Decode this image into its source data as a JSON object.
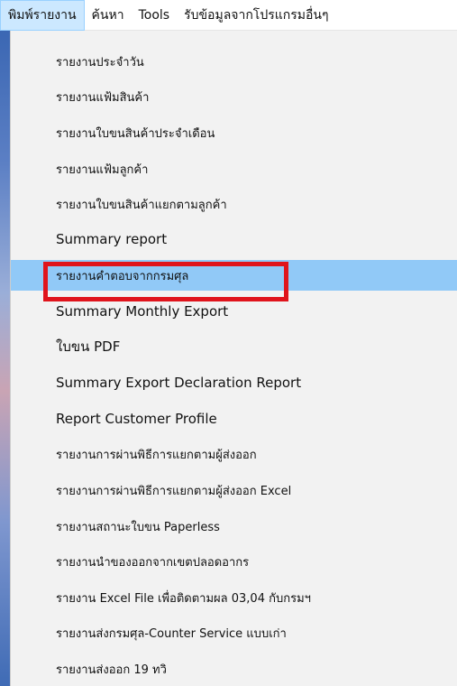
{
  "menubar": {
    "items": [
      {
        "label": "พิมพ์รายงาน"
      },
      {
        "label": "ค้นหา"
      },
      {
        "label": "Tools"
      },
      {
        "label": "รับข้อมูลจากโปรแกรมอื่นๆ"
      }
    ]
  },
  "dropdown": {
    "items": [
      {
        "label": "รายงานประจำวัน"
      },
      {
        "label": "รายงานแฟ้มสินค้า"
      },
      {
        "label": "รายงานใบขนสินค้าประจำเดือน"
      },
      {
        "label": "รายงานแฟ้มลูกค้า"
      },
      {
        "label": "รายงานใบขนสินค้าแยกตามลูกค้า"
      },
      {
        "label": "Summary report"
      },
      {
        "label": "รายงานคำตอบจากกรมศุล"
      },
      {
        "label": "Summary Monthly Export"
      },
      {
        "label": "ใบขน PDF"
      },
      {
        "label": "Summary Export Declaration Report"
      },
      {
        "label": "Report Customer Profile"
      },
      {
        "label": "รายงานการผ่านพิธีการแยกตามผู้ส่งออก"
      },
      {
        "label": "รายงานการผ่านพิธีการแยกตามผู้ส่งออก Excel"
      },
      {
        "label": "รายงานสถานะใบขน Paperless"
      },
      {
        "label": "รายงานนำของออกจากเขตปลอดอากร"
      },
      {
        "label": "รายงาน Excel File เพื่อติดตามผล 03,04 กับกรมฯ"
      },
      {
        "label": "รายงานส่งกรมศุล-Counter Service แบบเก่า"
      },
      {
        "label": "รายงานส่งออก 19 ทวิ"
      }
    ]
  },
  "colors": {
    "highlight": "#91c9f7",
    "annotation": "#e0141c"
  }
}
